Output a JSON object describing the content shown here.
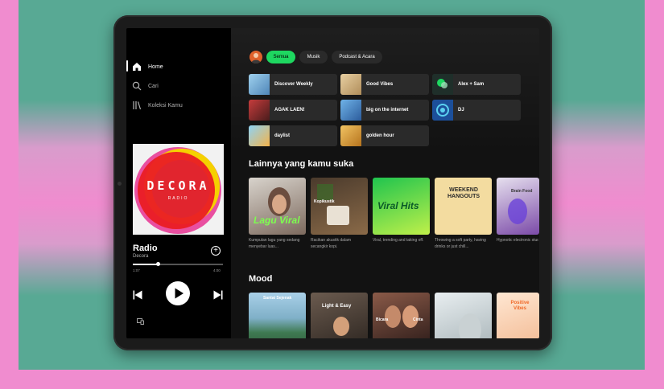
{
  "sidebar": {
    "items": [
      {
        "label": "Home",
        "icon": "home-icon",
        "active": true
      },
      {
        "label": "Cari",
        "icon": "search-icon",
        "active": false
      },
      {
        "label": "Koleksi Kamu",
        "icon": "library-icon",
        "active": false
      }
    ]
  },
  "now_playing": {
    "album_text": "DECORA",
    "album_subtext": "RADIO",
    "title": "Radio",
    "artist": "Decora",
    "elapsed": "1:07",
    "total": "4:00",
    "progress": 0.28
  },
  "filters": [
    {
      "label": "Semua",
      "active": true
    },
    {
      "label": "Musik",
      "active": false
    },
    {
      "label": "Podcast & Acara",
      "active": false
    }
  ],
  "quick_picks": [
    {
      "label": "Discover Weekly",
      "color": "#7fb7d9"
    },
    {
      "label": "Good Vibes",
      "color": "#d7b98a"
    },
    {
      "label": "Alex + Sam",
      "color": "#2d3f39"
    },
    {
      "label": "AGAK LAEN!",
      "color": "#9a2b2b"
    },
    {
      "label": "big on the internet",
      "color": "#3e7fbf"
    },
    {
      "label": "DJ",
      "color": "#2b5fa8"
    },
    {
      "label": "daylist",
      "color": "#7ec6f0"
    },
    {
      "label": "golden hour",
      "color": "#e0a33a"
    }
  ],
  "sections": {
    "recommended": {
      "title": "Lainnya yang kamu suka",
      "cards": [
        {
          "art_label": "Lagu Viral",
          "desc": "Kumpulan lagu yang sedang menyebar luas..."
        },
        {
          "art_label": "Kopikustik",
          "desc": "Racikan akustik dalam secangkir kopi."
        },
        {
          "art_label": "Viral Hits",
          "desc": "Viral, trending and taking off."
        },
        {
          "art_label": "WEEKEND HANGOUTS",
          "desc": "Throwing a soft party, having drinks or just chill..."
        },
        {
          "art_label": "Brain Food",
          "desc": "Hypnotic electronic studios and a relax..."
        }
      ]
    },
    "mood": {
      "title": "Mood",
      "cards": [
        {
          "art_label": "Santai Sejenak"
        },
        {
          "art_label": "Light & Easy"
        },
        {
          "art_label": "Bicara",
          "art_label2": "Cinta"
        },
        {
          "art_label": ""
        },
        {
          "art_label": "Positive Vibes"
        }
      ]
    }
  }
}
